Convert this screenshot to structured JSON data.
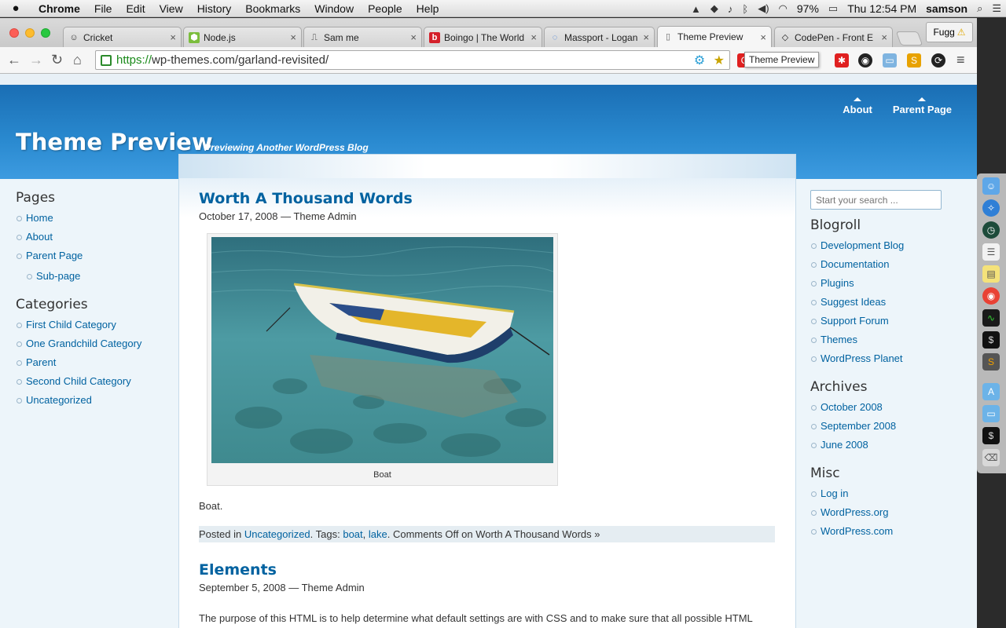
{
  "menubar": {
    "apple": "",
    "items": [
      "Chrome",
      "File",
      "Edit",
      "View",
      "History",
      "Bookmarks",
      "Window",
      "People",
      "Help"
    ],
    "battery": "97%",
    "clock": "Thu 12:54 PM",
    "user": "samson"
  },
  "tabs": [
    {
      "title": "Cricket",
      "close": "×"
    },
    {
      "title": "Node.js",
      "close": "×"
    },
    {
      "title": "Sam me",
      "close": "×"
    },
    {
      "title": "Boingo | The World",
      "close": "×"
    },
    {
      "title": "Massport - Logan",
      "close": "×"
    },
    {
      "title": "Theme Preview",
      "close": "×"
    },
    {
      "title": "CodePen - Front E",
      "close": "×"
    }
  ],
  "fugg_label": "Fugg",
  "address": {
    "scheme": "https://",
    "rest": "wp-themes.com/garland-revisited/"
  },
  "tooltip": "Theme Preview",
  "colors": {
    "accent": "#0062a0",
    "header_top": "#1a6eb4",
    "header_bottom": "#3d9be0"
  },
  "site": {
    "title": "Theme Preview",
    "slogan": "Previewing Another WordPress Blog",
    "nav": [
      "About",
      "Parent Page"
    ]
  },
  "left_sidebar": {
    "pages_title": "Pages",
    "pages": [
      "Home",
      "About",
      "Parent Page"
    ],
    "subpage": "Sub-page",
    "categories_title": "Categories",
    "categories": [
      "First Child Category",
      "One Grandchild Category",
      "Parent",
      "Second Child Category",
      "Uncategorized"
    ]
  },
  "right_sidebar": {
    "search_placeholder": "Start your search ...",
    "blogroll_title": "Blogroll",
    "blogroll": [
      "Development Blog",
      "Documentation",
      "Plugins",
      "Suggest Ideas",
      "Support Forum",
      "Themes",
      "WordPress Planet"
    ],
    "archives_title": "Archives",
    "archives": [
      "October 2008",
      "September 2008",
      "June 2008"
    ],
    "misc_title": "Misc",
    "misc": [
      "Log in",
      "WordPress.org",
      "WordPress.com"
    ]
  },
  "post1": {
    "title": "Worth A Thousand Words",
    "meta": "October 17, 2008 — Theme Admin",
    "caption": "Boat",
    "body": "Boat.",
    "posted_in": "Posted in",
    "category": "Uncategorized",
    "tags_label": ". Tags:",
    "tag1": "boat",
    "tag2": "lake",
    "comments": ". Comments Off on Worth A Thousand Words »"
  },
  "post2": {
    "title": "Elements",
    "meta": "September 5, 2008 — Theme Admin",
    "body": "The purpose of this HTML is to help determine what default settings are with CSS and to make sure that all possible HTML Elements are included in this HTML so as to not miss any possible Elements when designing a site."
  }
}
